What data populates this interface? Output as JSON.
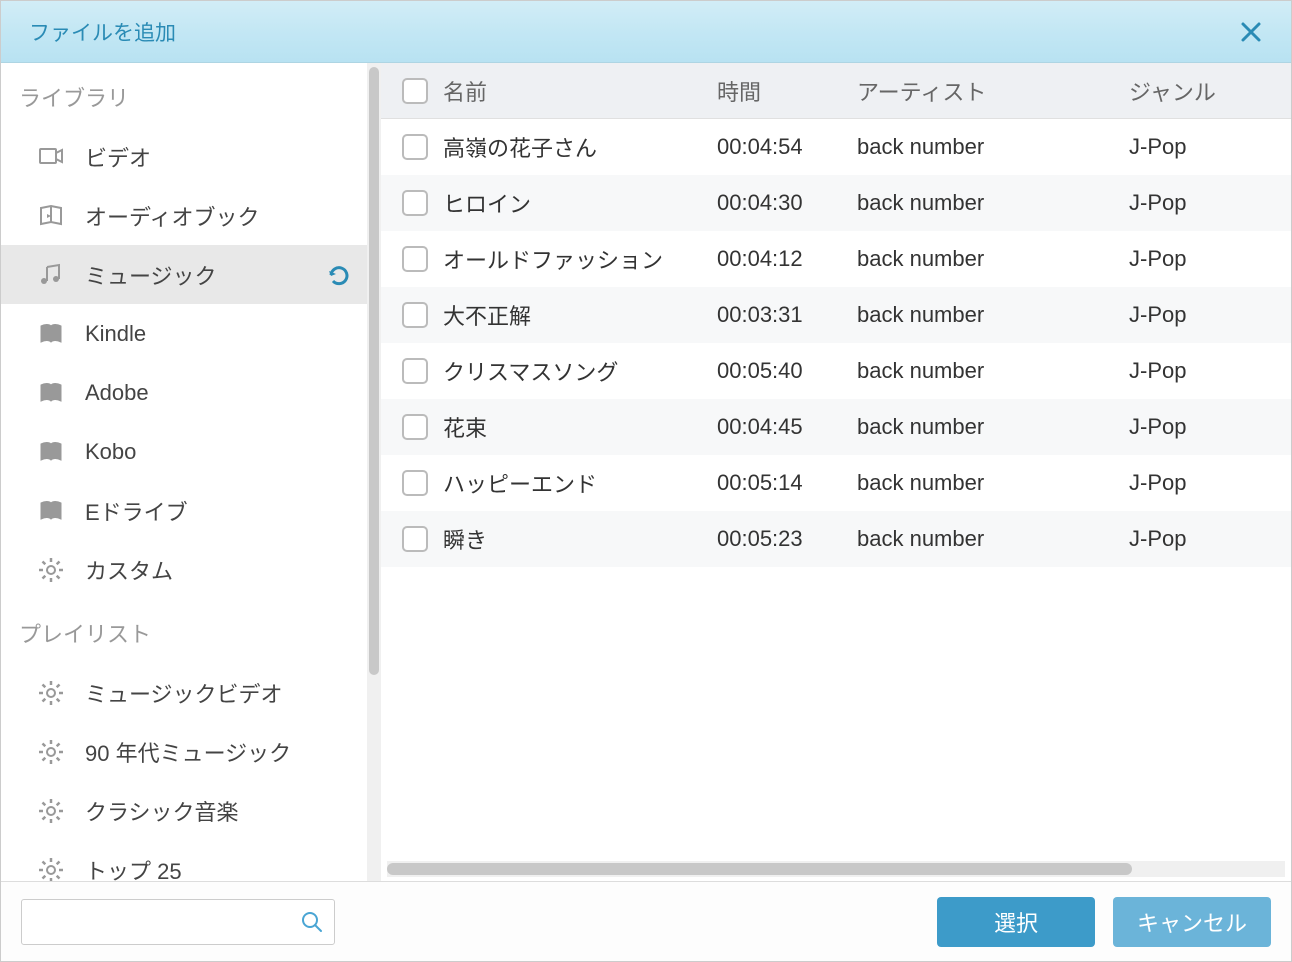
{
  "title": "ファイルを追加",
  "sidebar": {
    "sections": [
      {
        "header": "ライブラリ",
        "items": [
          {
            "icon": "video",
            "label": "ビデオ",
            "selected": false
          },
          {
            "icon": "audiobook",
            "label": "オーディオブック",
            "selected": false
          },
          {
            "icon": "music",
            "label": "ミュージック",
            "selected": true,
            "refresh": true
          },
          {
            "icon": "book",
            "label": "Kindle",
            "selected": false
          },
          {
            "icon": "book",
            "label": "Adobe",
            "selected": false
          },
          {
            "icon": "book",
            "label": "Kobo",
            "selected": false
          },
          {
            "icon": "book",
            "label": "Eドライブ",
            "selected": false
          },
          {
            "icon": "gear",
            "label": "カスタム",
            "selected": false
          }
        ]
      },
      {
        "header": "プレイリスト",
        "items": [
          {
            "icon": "gear",
            "label": "ミュージックビデオ",
            "selected": false
          },
          {
            "icon": "gear",
            "label": "90 年代ミュージック",
            "selected": false
          },
          {
            "icon": "gear",
            "label": "クラシック音楽",
            "selected": false
          },
          {
            "icon": "gear",
            "label": "トップ 25",
            "selected": false
          }
        ]
      }
    ]
  },
  "table": {
    "columns": {
      "name": "名前",
      "time": "時間",
      "artist": "アーティスト",
      "genre": "ジャンル"
    },
    "rows": [
      {
        "name": "高嶺の花子さん",
        "time": "00:04:54",
        "artist": "back number",
        "genre": "J-Pop"
      },
      {
        "name": "ヒロイン",
        "time": "00:04:30",
        "artist": "back number",
        "genre": "J-Pop"
      },
      {
        "name": "オールドファッション",
        "time": "00:04:12",
        "artist": "back number",
        "genre": "J-Pop"
      },
      {
        "name": "大不正解",
        "time": "00:03:31",
        "artist": "back number",
        "genre": "J-Pop"
      },
      {
        "name": "クリスマスソング",
        "time": "00:05:40",
        "artist": "back number",
        "genre": "J-Pop"
      },
      {
        "name": "花束",
        "time": "00:04:45",
        "artist": "back number",
        "genre": "J-Pop"
      },
      {
        "name": "ハッピーエンド",
        "time": "00:05:14",
        "artist": "back number",
        "genre": "J-Pop"
      },
      {
        "name": "瞬き",
        "time": "00:05:23",
        "artist": "back number",
        "genre": "J-Pop"
      }
    ]
  },
  "footer": {
    "search_placeholder": "",
    "select_label": "選択",
    "cancel_label": "キャンセル"
  }
}
